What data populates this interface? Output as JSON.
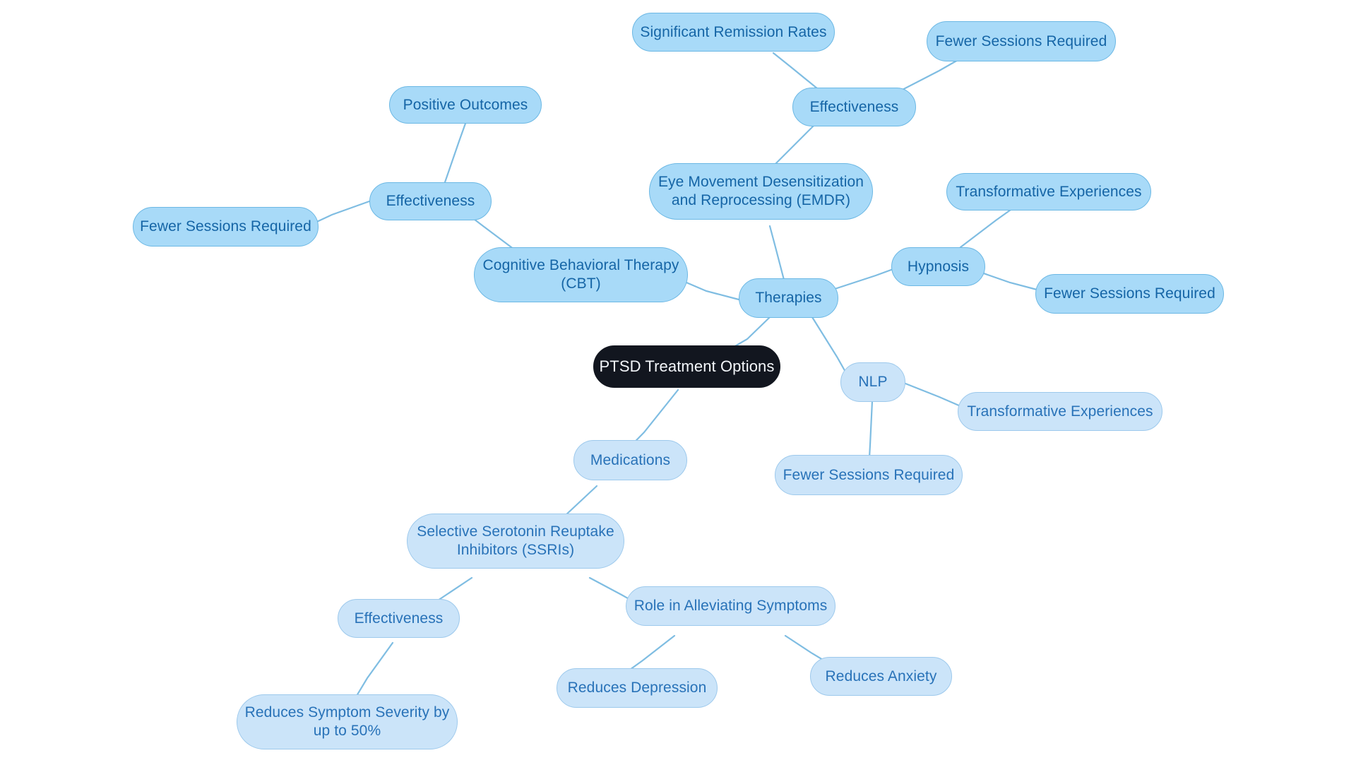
{
  "diagram": {
    "title": "PTSD Treatment Options",
    "type": "mind-map",
    "background_color": "#ffffff",
    "colors": {
      "root_fill": "#12161f",
      "root_text": "#f3f6fa",
      "branch_fill": "#a8daf8",
      "branch_border": "#6cb8e4",
      "branch_text": "#1565a6",
      "leaf_fill": "#cbe4f9",
      "leaf_border": "#9dc9ec",
      "leaf_text": "#2872b8",
      "edge": "#7fbde2"
    }
  },
  "nodes": {
    "root": "PTSD Treatment Options",
    "therapies": "Therapies",
    "medications": "Medications",
    "cbt": "Cognitive Behavioral Therapy\n(CBT)",
    "cbt_effectiveness": "Effectiveness",
    "cbt_positive_outcomes": "Positive Outcomes",
    "cbt_fewer_sessions": "Fewer Sessions Required",
    "emdr": "Eye Movement Desensitization\nand Reprocessing (EMDR)",
    "emdr_effectiveness": "Effectiveness",
    "emdr_remission": "Significant Remission Rates",
    "emdr_fewer_sessions": "Fewer Sessions Required",
    "hypnosis": "Hypnosis",
    "hypnosis_transformative": "Transformative Experiences",
    "hypnosis_fewer_sessions": "Fewer Sessions Required",
    "nlp": "NLP",
    "nlp_transformative": "Transformative Experiences",
    "nlp_fewer_sessions": "Fewer Sessions Required",
    "ssri": "Selective Serotonin Reuptake\nInhibitors (SSRIs)",
    "ssri_effectiveness": "Effectiveness",
    "ssri_severity": "Reduces Symptom Severity by\nup to 50%",
    "ssri_role": "Role in Alleviating Symptoms",
    "ssri_depression": "Reduces Depression",
    "ssri_anxiety": "Reduces Anxiety"
  },
  "chart_data": {
    "type": "diagram",
    "title": "PTSD Treatment Options",
    "hierarchy": [
      {
        "label": "PTSD Treatment Options",
        "level": 0,
        "children": [
          {
            "label": "Therapies",
            "level": 1,
            "children": [
              {
                "label": "Cognitive Behavioral Therapy (CBT)",
                "level": 2,
                "children": [
                  {
                    "label": "Effectiveness",
                    "level": 3,
                    "children": [
                      {
                        "label": "Positive Outcomes",
                        "level": 4,
                        "children": []
                      },
                      {
                        "label": "Fewer Sessions Required",
                        "level": 4,
                        "children": []
                      }
                    ]
                  }
                ]
              },
              {
                "label": "Eye Movement Desensitization and Reprocessing (EMDR)",
                "level": 2,
                "children": [
                  {
                    "label": "Effectiveness",
                    "level": 3,
                    "children": [
                      {
                        "label": "Significant Remission Rates",
                        "level": 4,
                        "children": []
                      },
                      {
                        "label": "Fewer Sessions Required",
                        "level": 4,
                        "children": []
                      }
                    ]
                  }
                ]
              },
              {
                "label": "Hypnosis",
                "level": 2,
                "children": [
                  {
                    "label": "Transformative Experiences",
                    "level": 3,
                    "children": []
                  },
                  {
                    "label": "Fewer Sessions Required",
                    "level": 3,
                    "children": []
                  }
                ]
              },
              {
                "label": "NLP",
                "level": 2,
                "children": [
                  {
                    "label": "Transformative Experiences",
                    "level": 3,
                    "children": []
                  },
                  {
                    "label": "Fewer Sessions Required",
                    "level": 3,
                    "children": []
                  }
                ]
              }
            ]
          },
          {
            "label": "Medications",
            "level": 1,
            "children": [
              {
                "label": "Selective Serotonin Reuptake Inhibitors (SSRIs)",
                "level": 2,
                "children": [
                  {
                    "label": "Effectiveness",
                    "level": 3,
                    "children": [
                      {
                        "label": "Reduces Symptom Severity by up to 50%",
                        "level": 4,
                        "children": []
                      }
                    ]
                  },
                  {
                    "label": "Role in Alleviating Symptoms",
                    "level": 3,
                    "children": [
                      {
                        "label": "Reduces Depression",
                        "level": 4,
                        "children": []
                      },
                      {
                        "label": "Reduces Anxiety",
                        "level": 4,
                        "children": []
                      }
                    ]
                  }
                ]
              }
            ]
          }
        ]
      }
    ]
  }
}
